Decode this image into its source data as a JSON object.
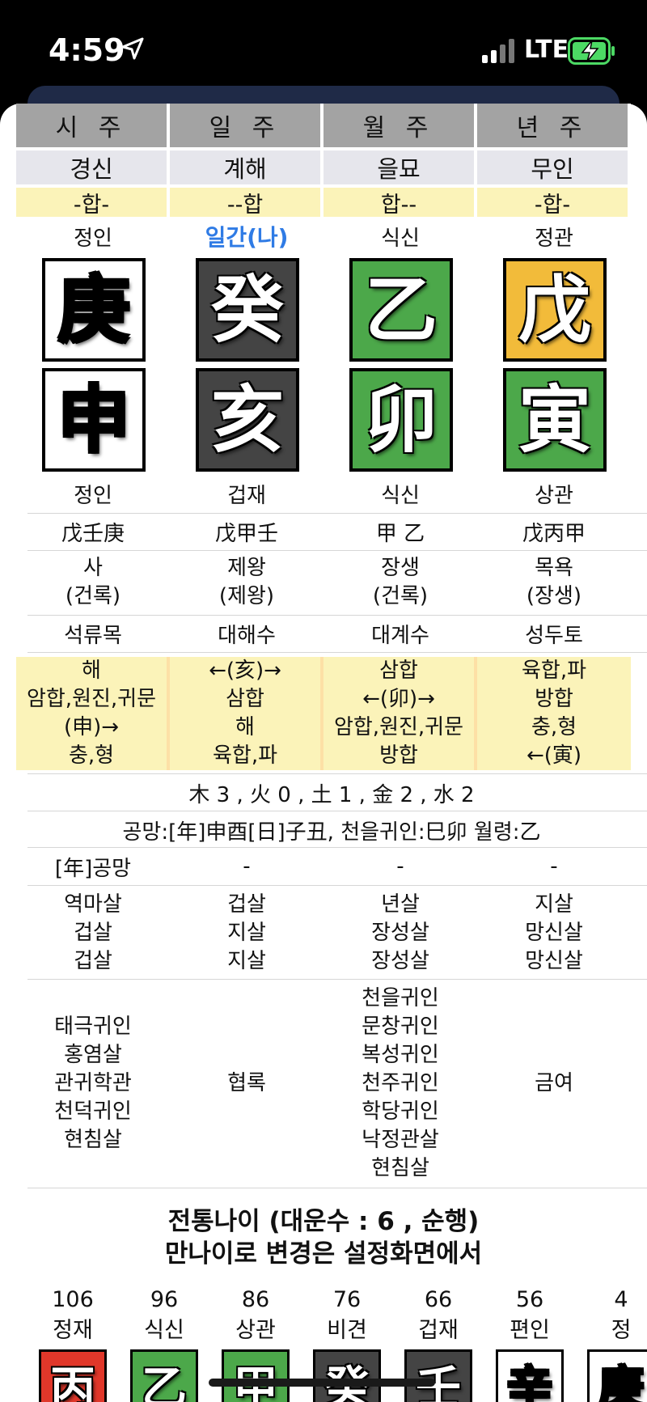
{
  "status_bar": {
    "time": "4:59",
    "network": "LTE"
  },
  "headers": [
    "시 주",
    "일 주",
    "월 주",
    "년 주"
  ],
  "pillar_names": [
    "경신",
    "계해",
    "을묘",
    "무인"
  ],
  "hap_marks": [
    "-합-",
    "--합",
    "합--",
    "-합-"
  ],
  "stem_gods": [
    "정인",
    "일간(나)",
    "식신",
    "정관"
  ],
  "stems": [
    {
      "char": "庚",
      "color": "white"
    },
    {
      "char": "癸",
      "color": "dark"
    },
    {
      "char": "乙",
      "color": "green"
    },
    {
      "char": "戊",
      "color": "yellow"
    }
  ],
  "branches": [
    {
      "char": "申",
      "color": "white"
    },
    {
      "char": "亥",
      "color": "dark"
    },
    {
      "char": "卯",
      "color": "green"
    },
    {
      "char": "寅",
      "color": "green"
    }
  ],
  "branch_gods": [
    "정인",
    "겁재",
    "식신",
    "상관"
  ],
  "hidden_stems": [
    "戊壬庚",
    "戊甲壬",
    "甲 乙",
    "戊丙甲"
  ],
  "twelve_states": [
    {
      "line1": "사",
      "line2": "(건록)"
    },
    {
      "line1": "제왕",
      "line2": "(제왕)"
    },
    {
      "line1": "장생",
      "line2": "(건록)"
    },
    {
      "line1": "목욕",
      "line2": "(장생)"
    }
  ],
  "napeum": [
    "석류목",
    "대해수",
    "대계수",
    "성두토"
  ],
  "relations": [
    [
      "해",
      "암합,원진,귀문",
      "(申)→",
      "충,형"
    ],
    [
      "←(亥)→",
      "삼합",
      "해",
      "육합,파"
    ],
    [
      "삼합",
      "←(卯)→",
      "암합,원진,귀문",
      "방합"
    ],
    [
      "육합,파",
      "방합",
      "충,형",
      "←(寅)"
    ]
  ],
  "elements_summary": "木 3 , 火 0 , 土 1 , 金 2 , 水 2",
  "gongmang_line": "공망:[年]申酉[日]子丑, 천을귀인:巳卯 월령:乙",
  "gongmang_row": [
    "[年]공망",
    "-",
    "-",
    "-"
  ],
  "sals": [
    [
      "역마살",
      "겁살",
      "겁살"
    ],
    [
      "겁살",
      "지살",
      "지살"
    ],
    [
      "년살",
      "장성살",
      "장성살"
    ],
    [
      "지살",
      "망신살",
      "망신살"
    ]
  ],
  "gwiin": [
    [
      "태극귀인",
      "홍염살",
      "관귀학관",
      "천덕귀인",
      "현침살"
    ],
    [
      "협록"
    ],
    [
      "천을귀인",
      "문창귀인",
      "복성귀인",
      "천주귀인",
      "학당귀인",
      "낙정관살",
      "현침살"
    ],
    [
      "금여"
    ]
  ],
  "daeun_title": "전통나이 (대운수 : 6 , 순행)",
  "daeun_subtitle": "만나이로 변경은 설정화면에서",
  "daeun": [
    {
      "age": "106",
      "god": "정재",
      "char": "丙",
      "color": "red"
    },
    {
      "age": "96",
      "god": "식신",
      "char": "乙",
      "color": "green"
    },
    {
      "age": "86",
      "god": "상관",
      "char": "甲",
      "color": "green"
    },
    {
      "age": "76",
      "god": "비견",
      "char": "癸",
      "color": "dark"
    },
    {
      "age": "66",
      "god": "겁재",
      "char": "壬",
      "color": "dark"
    },
    {
      "age": "56",
      "god": "편인",
      "char": "辛",
      "color": "white"
    },
    {
      "age": "4",
      "god": "정",
      "char": "庚",
      "color": "white"
    }
  ],
  "colors": {
    "header": "#a3a3a3",
    "hap": "#fbf3b9",
    "ilgan": "#2f7be5",
    "green": "#4ca84a",
    "yellow": "#f2bb3a",
    "dark": "#444444",
    "red": "#e0372a"
  }
}
